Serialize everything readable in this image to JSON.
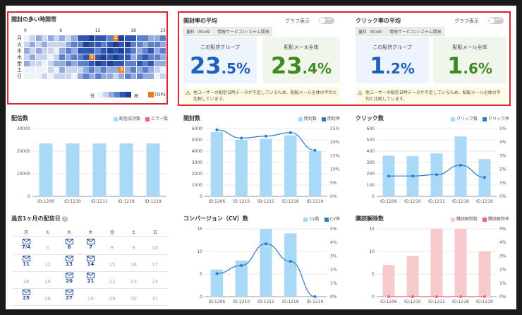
{
  "heatmap": {
    "title": "開封の多い時間帯",
    "hour_labels": [
      "0",
      "6",
      "12",
      "18",
      "23"
    ],
    "days": [
      "月",
      "火",
      "水",
      "木",
      "金",
      "土",
      "日"
    ],
    "legend_low": "低",
    "legend_high": "高",
    "legend_top3": "TOP3",
    "top3": [
      {
        "day": 0,
        "hour": 15,
        "rank": "2"
      },
      {
        "day": 3,
        "hour": 11,
        "rank": "1"
      },
      {
        "day": 5,
        "hour": 16,
        "rank": "3"
      }
    ],
    "colors": [
      "#eef2fb",
      "#c9d5ef",
      "#93aadf",
      "#5d7fcc",
      "#2f56b3",
      "#1f3f94"
    ],
    "top_color": "#e87f1b"
  },
  "open_rate": {
    "title": "開封率の平均",
    "toggle_label": "グラフ表示",
    "toggle_state": "OFF",
    "tags": [
      "蓋料（BtoB）",
      "情報サービス/システム開発"
    ],
    "group_label": "この配信グループ",
    "group_int": "23",
    "group_dec": ".5%",
    "all_label": "配配メール全体",
    "all_int": "23",
    "all_dec": ".4%",
    "warning": "他ユーザーの配信日時データが不足しているため、配配メール全体の平均と比較しています。"
  },
  "click_rate": {
    "title": "クリック率の平均",
    "toggle_label": "グラフ表示",
    "toggle_state": "OFF",
    "tags": [
      "蓋料（BtoB）",
      "情報サービス/システム開発"
    ],
    "group_label": "この配信グループ",
    "group_int": "1",
    "group_dec": ".2%",
    "all_label": "配配メール全体",
    "all_int": "1",
    "all_dec": ".6%",
    "warning": "他ユーザーの配信日時データが不足しているため、配配メール全体の平均と比較しています。"
  },
  "delivery": {
    "title": "配信数",
    "legend": [
      "配信成功数",
      "エラー数"
    ]
  },
  "opens": {
    "title": "開封数",
    "legend": [
      "開封数",
      "開封率"
    ]
  },
  "clicks": {
    "title": "クリック数",
    "legend": [
      "クリック数",
      "クリック率"
    ]
  },
  "conversion": {
    "title": "コンバージョン（CV）数",
    "legend": [
      "CV数",
      "CV率"
    ]
  },
  "unsub": {
    "title": "購読解除数",
    "legend": [
      "購読解除数",
      "購読解除率"
    ]
  },
  "calendar": {
    "title": "過去1ヶ月の配信日",
    "weekdays": [
      "月",
      "火",
      "水",
      "木",
      "金",
      "土",
      "日"
    ],
    "weeks": [
      [
        {
          "d": "7/4",
          "s": true
        },
        {
          "d": "5",
          "s": false
        },
        {
          "d": "6",
          "s": true
        },
        {
          "d": "7",
          "s": true
        },
        {
          "d": "8",
          "s": false
        },
        {
          "d": "9",
          "s": false
        },
        {
          "d": "10",
          "s": false
        }
      ],
      [
        {
          "d": "11",
          "s": true
        },
        {
          "d": "12",
          "s": false
        },
        {
          "d": "13",
          "s": true
        },
        {
          "d": "14",
          "s": true
        },
        {
          "d": "15",
          "s": false
        },
        {
          "d": "16",
          "s": false
        },
        {
          "d": "17",
          "s": false
        }
      ],
      [
        {
          "d": "18",
          "s": false
        },
        {
          "d": "19",
          "s": false
        },
        {
          "d": "20",
          "s": true
        },
        {
          "d": "21",
          "s": true
        },
        {
          "d": "22",
          "s": false
        },
        {
          "d": "23",
          "s": false
        },
        {
          "d": "24",
          "s": false
        }
      ],
      [
        {
          "d": "25",
          "s": true
        },
        {
          "d": "26",
          "s": false
        },
        {
          "d": "27",
          "s": true
        },
        {
          "d": "28",
          "s": false
        },
        {
          "d": "29",
          "s": false
        },
        {
          "d": "30",
          "s": false
        },
        {
          "d": "31",
          "s": false
        }
      ]
    ]
  },
  "chart_data": [
    {
      "type": "bar",
      "title": "配信数",
      "categories": [
        "ID:1206",
        "ID:1210",
        "ID:1211",
        "ID:1218",
        "ID:1219"
      ],
      "series": [
        {
          "name": "配信成功数",
          "values": [
            23400,
            23400,
            23400,
            23400,
            23400
          ],
          "color": "#aad8f7"
        },
        {
          "name": "エラー数",
          "values": [
            0,
            0,
            0,
            0,
            0
          ],
          "color": "#e9667c"
        }
      ],
      "ylim": [
        0,
        30000
      ],
      "yticks": [
        "0",
        "10000",
        "20000",
        "30000"
      ]
    },
    {
      "type": "bar",
      "title": "開封数",
      "categories": [
        "ID:1206",
        "ID:1210",
        "ID:1211",
        "ID:1218",
        "ID:1219"
      ],
      "series": [
        {
          "name": "開封数",
          "values": [
            5700,
            5000,
            5100,
            5400,
            4000
          ],
          "color": "#aad8f7"
        },
        {
          "name": "開封率",
          "values": [
            24.5,
            21.5,
            22.2,
            23.5,
            17
          ],
          "color": "#2a7ccf",
          "kind": "line",
          "axis": "right"
        }
      ],
      "ylim": [
        0,
        6000
      ],
      "y2lim": [
        0,
        25
      ],
      "yticks": [
        "0",
        "1000",
        "2000",
        "3000",
        "4000",
        "5000",
        "6000"
      ],
      "y2ticks": [
        "0%",
        "5%",
        "10%",
        "15%",
        "20%",
        "25%"
      ]
    },
    {
      "type": "bar",
      "title": "クリック数",
      "categories": [
        "ID:1206",
        "ID:1210",
        "ID:1211",
        "ID:1218",
        "ID:1219"
      ],
      "series": [
        {
          "name": "クリック数",
          "values": [
            360,
            355,
            380,
            530,
            330
          ],
          "color": "#aad8f7"
        },
        {
          "name": "クリック率",
          "values": [
            1.5,
            1.5,
            1.6,
            2.3,
            1.4
          ],
          "color": "#2a7ccf",
          "kind": "line",
          "axis": "right"
        }
      ],
      "ylim": [
        0,
        600
      ],
      "y2lim": [
        0,
        5
      ],
      "yticks": [
        "0",
        "100",
        "200",
        "300",
        "400",
        "500",
        "600"
      ],
      "y2ticks": [
        "0%",
        "1%",
        "2%",
        "3%",
        "4%",
        "5%"
      ]
    },
    {
      "type": "bar",
      "title": "コンバージョン（CV）数",
      "categories": [
        "ID:1206",
        "ID:1210",
        "ID:1211",
        "ID:1218",
        "ID:1219"
      ],
      "series": [
        {
          "name": "CV数",
          "values": [
            6,
            8,
            15,
            14,
            0
          ],
          "color": "#aad8f7"
        },
        {
          "name": "CV率",
          "values": [
            1.7,
            2.3,
            3.9,
            2.6,
            0
          ],
          "color": "#2a7ccf",
          "kind": "line",
          "axis": "right"
        }
      ],
      "ylim": [
        0,
        15
      ],
      "y2lim": [
        0,
        5
      ],
      "yticks": [
        "0",
        "5",
        "10",
        "15"
      ],
      "y2ticks": [
        "0%",
        "1%",
        "2%",
        "3%",
        "4%",
        "5%"
      ]
    },
    {
      "type": "bar",
      "title": "購読解除数",
      "categories": [
        "ID:1206",
        "ID:1210",
        "ID:1211",
        "ID:1218",
        "ID:1219"
      ],
      "series": [
        {
          "name": "購読解除数",
          "values": [
            7,
            9,
            15,
            15,
            10
          ],
          "color": "#f6c9cc"
        },
        {
          "name": "購読解除率",
          "values": [
            0,
            0,
            0,
            0,
            0
          ],
          "color": "#e9667c",
          "kind": "line",
          "axis": "right"
        }
      ],
      "ylim": [
        0,
        15
      ],
      "y2lim": [
        0,
        5
      ],
      "yticks": [
        "0",
        "5",
        "10",
        "15"
      ],
      "y2ticks": [
        "0%",
        "1%",
        "2%",
        "3%",
        "4%",
        "5%"
      ]
    }
  ]
}
